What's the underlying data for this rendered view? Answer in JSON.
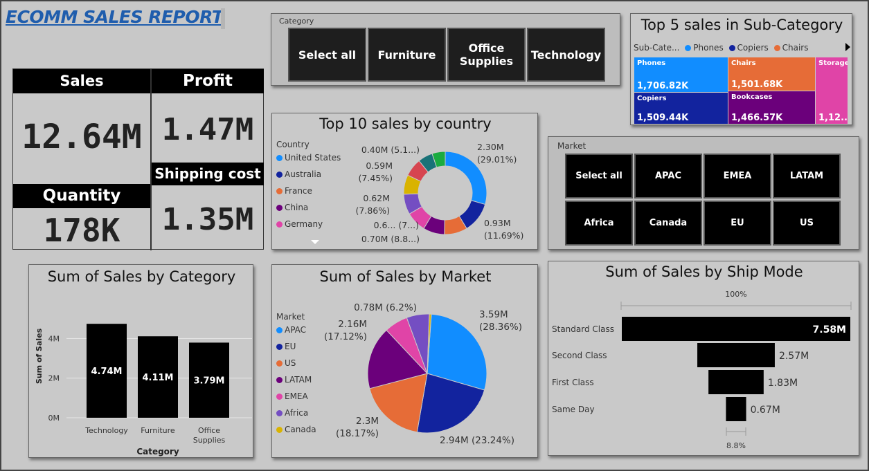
{
  "report_title": "ECOMM SALES REPORT",
  "kpis": {
    "sales_label": "Sales",
    "sales_value": "12.64M",
    "profit_label": "Profit",
    "profit_value": "1.47M",
    "quantity_label": "Quantity",
    "quantity_value": "178K",
    "shipping_label": "Shipping cost",
    "shipping_value": "1.35M"
  },
  "category_slicer": {
    "label": "Category",
    "options": [
      "Select all",
      "Furniture",
      "Office Supplies",
      "Technology"
    ]
  },
  "market_slicer": {
    "label": "Market",
    "options": [
      "Select all",
      "APAC",
      "EMEA",
      "LATAM",
      "Africa",
      "Canada",
      "EU",
      "US"
    ]
  },
  "colors": {
    "blue": "#118DFF",
    "navy": "#12239E",
    "orange": "#E66C37",
    "purple": "#6B007B",
    "pink": "#E044A7",
    "violet": "#744EC2",
    "yellow": "#D9B300",
    "red": "#D64550",
    "teal": "#197278",
    "green": "#1AAB40"
  },
  "chart_data": [
    {
      "id": "subcategory_treemap",
      "type": "treemap",
      "title": "Top 5 sales in Sub-Category",
      "legend_title": "Sub-Cate...",
      "legend": [
        "Phones",
        "Copiers",
        "Chairs"
      ],
      "items": [
        {
          "name": "Phones",
          "label": "1,706.82K",
          "value": 1706.82,
          "color": "#118DFF"
        },
        {
          "name": "Chairs",
          "label": "1,501.68K",
          "value": 1501.68,
          "color": "#E66C37"
        },
        {
          "name": "Storage",
          "label": "1,12...",
          "value": 1120,
          "color": "#E044A7"
        },
        {
          "name": "Copiers",
          "label": "1,509.44K",
          "value": 1509.44,
          "color": "#12239E"
        },
        {
          "name": "Bookcases",
          "label": "1,466.57K",
          "value": 1466.57,
          "color": "#6B007B"
        }
      ]
    },
    {
      "id": "country_donut",
      "type": "donut",
      "title": "Top 10 sales by country",
      "legend_title": "Country",
      "legend": [
        "United States",
        "Australia",
        "France",
        "China",
        "Germany"
      ],
      "slices": [
        {
          "value": 2.3,
          "label_value": "2.30M",
          "label_pct": "(29.01%)",
          "color": "#118DFF"
        },
        {
          "value": 0.93,
          "label_value": "0.93M",
          "label_pct": "(11.69%)",
          "color": "#12239E"
        },
        {
          "value": 0.7,
          "label_value": "0.70M (8.8...)",
          "label_pct": "",
          "color": "#E66C37"
        },
        {
          "value": 0.65,
          "label_value": "0.6... (7...)",
          "label_pct": "",
          "color": "#6B007B"
        },
        {
          "value": 0.62,
          "label_value": "0.62M",
          "label_pct": "(7.86%)",
          "color": "#E044A7"
        },
        {
          "value": 0.62,
          "label_value": "",
          "label_pct": "",
          "color": "#744EC2"
        },
        {
          "value": 0.59,
          "label_value": "0.59M",
          "label_pct": "(7.45%)",
          "color": "#D9B300"
        },
        {
          "value": 0.55,
          "label_value": "",
          "label_pct": "",
          "color": "#D64550"
        },
        {
          "value": 0.45,
          "label_value": "",
          "label_pct": "",
          "color": "#197278"
        },
        {
          "value": 0.4,
          "label_value": "0.40M (5.1...)",
          "label_pct": "",
          "color": "#1AAB40"
        }
      ]
    },
    {
      "id": "category_bar",
      "type": "bar",
      "title": "Sum of Sales by Category",
      "xlabel": "Category",
      "ylabel": "Sum of Sales",
      "categories": [
        "Technology",
        "Furniture",
        "Office Supplies"
      ],
      "values": [
        4.74,
        4.11,
        3.79
      ],
      "value_labels": [
        "4.74M",
        "4.11M",
        "3.79M"
      ],
      "yticks": [
        "0M",
        "2M",
        "4M"
      ],
      "ylim": [
        0,
        5.2
      ]
    },
    {
      "id": "market_pie",
      "type": "pie",
      "title": "Sum of Sales by Market",
      "legend_title": "Market",
      "legend": [
        "APAC",
        "EU",
        "US",
        "LATAM",
        "EMEA",
        "Africa",
        "Canada"
      ],
      "slices": [
        {
          "name": "APAC",
          "value": 3.59,
          "label": "3.59M\n(28.36%)",
          "color": "#118DFF"
        },
        {
          "name": "EU",
          "value": 2.94,
          "label": "2.94M (23.24%)",
          "color": "#12239E"
        },
        {
          "name": "US",
          "value": 2.3,
          "label": "2.3M\n(18.17%)",
          "color": "#E66C37"
        },
        {
          "name": "LATAM",
          "value": 2.16,
          "label": "2.16M\n(17.12%)",
          "color": "#6B007B"
        },
        {
          "name": "EMEA",
          "value": 0.81,
          "label": "",
          "color": "#E044A7"
        },
        {
          "name": "Africa",
          "value": 0.78,
          "label": "0.78M (6.2%)",
          "color": "#744EC2"
        },
        {
          "name": "Canada",
          "value": 0.07,
          "label": "",
          "color": "#D9B300"
        }
      ]
    },
    {
      "id": "shipmode_funnel",
      "type": "funnel",
      "title": "Sum of Sales by Ship Mode",
      "top_pct": "100%",
      "bottom_pct": "8.8%",
      "categories": [
        "Standard Class",
        "Second Class",
        "First Class",
        "Same Day"
      ],
      "values": [
        7.58,
        2.57,
        1.83,
        0.67
      ],
      "value_labels": [
        "7.58M",
        "2.57M",
        "1.83M",
        "0.67M"
      ]
    }
  ]
}
